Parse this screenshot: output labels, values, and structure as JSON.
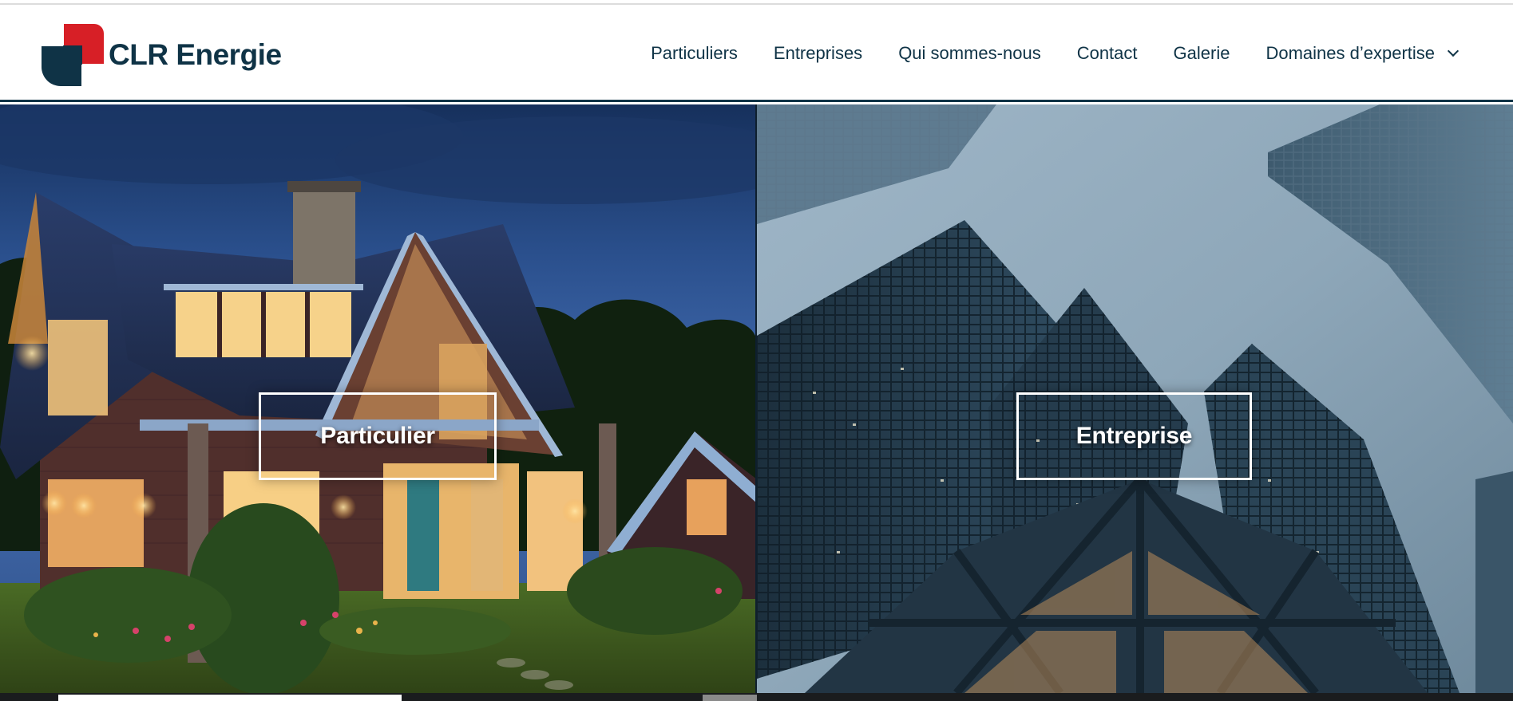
{
  "brand": {
    "name": "CLR Energie",
    "colors": {
      "navy": "#0f3346",
      "red": "#d71f26"
    }
  },
  "nav": {
    "items": [
      {
        "label": "Particuliers"
      },
      {
        "label": "Entreprises"
      },
      {
        "label": "Qui sommes-nous"
      },
      {
        "label": "Contact"
      },
      {
        "label": "Galerie"
      }
    ],
    "dropdown": {
      "label": "Domaines d’expertise",
      "icon": "chevron-down-icon"
    }
  },
  "panels": {
    "left": {
      "button_label": "Particulier",
      "image": "house-at-dusk"
    },
    "right": {
      "button_label": "Entreprise",
      "image": "office-skyscrapers"
    }
  }
}
